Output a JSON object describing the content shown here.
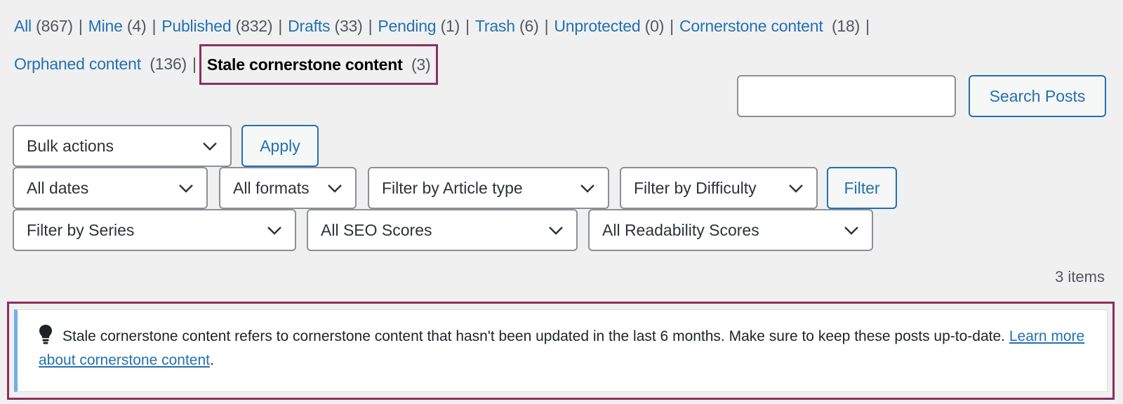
{
  "status_links": {
    "all": {
      "label": "All",
      "count": "(867)"
    },
    "mine": {
      "label": "Mine",
      "count": "(4)"
    },
    "published": {
      "label": "Published",
      "count": "(832)"
    },
    "drafts": {
      "label": "Drafts",
      "count": "(33)"
    },
    "pending": {
      "label": "Pending",
      "count": "(1)"
    },
    "trash": {
      "label": "Trash",
      "count": "(6)"
    },
    "unprotected": {
      "label": "Unprotected",
      "count": "(0)"
    },
    "cornerstone": {
      "label": "Cornerstone content",
      "count": "(18)"
    },
    "orphaned": {
      "label": "Orphaned content",
      "count": "(136)"
    },
    "stale": {
      "label": "Stale cornerstone content",
      "count": "(3)"
    },
    "separator": "|"
  },
  "search": {
    "value": "",
    "button_label": "Search Posts"
  },
  "bulk": {
    "selected": "Bulk actions",
    "apply_label": "Apply"
  },
  "filters": {
    "dates": "All dates",
    "formats": "All formats",
    "article_type": "Filter by Article type",
    "difficulty": "Filter by Difficulty",
    "filter_label": "Filter",
    "series": "Filter by Series",
    "seo": "All SEO Scores",
    "readability": "All Readability Scores"
  },
  "items_count": "3 items",
  "notice": {
    "icon": "lightbulb-icon",
    "text": "Stale cornerstone content refers to cornerstone content that hasn't been updated in the last 6 months. Make sure to keep these posts up-to-date.",
    "link": "Learn more about cornerstone content",
    "trailing": "."
  },
  "colors": {
    "link": "#2271b1",
    "highlight_border": "#8c2f5b",
    "notice_accent": "#72aee6",
    "background": "#f0f0f1"
  }
}
